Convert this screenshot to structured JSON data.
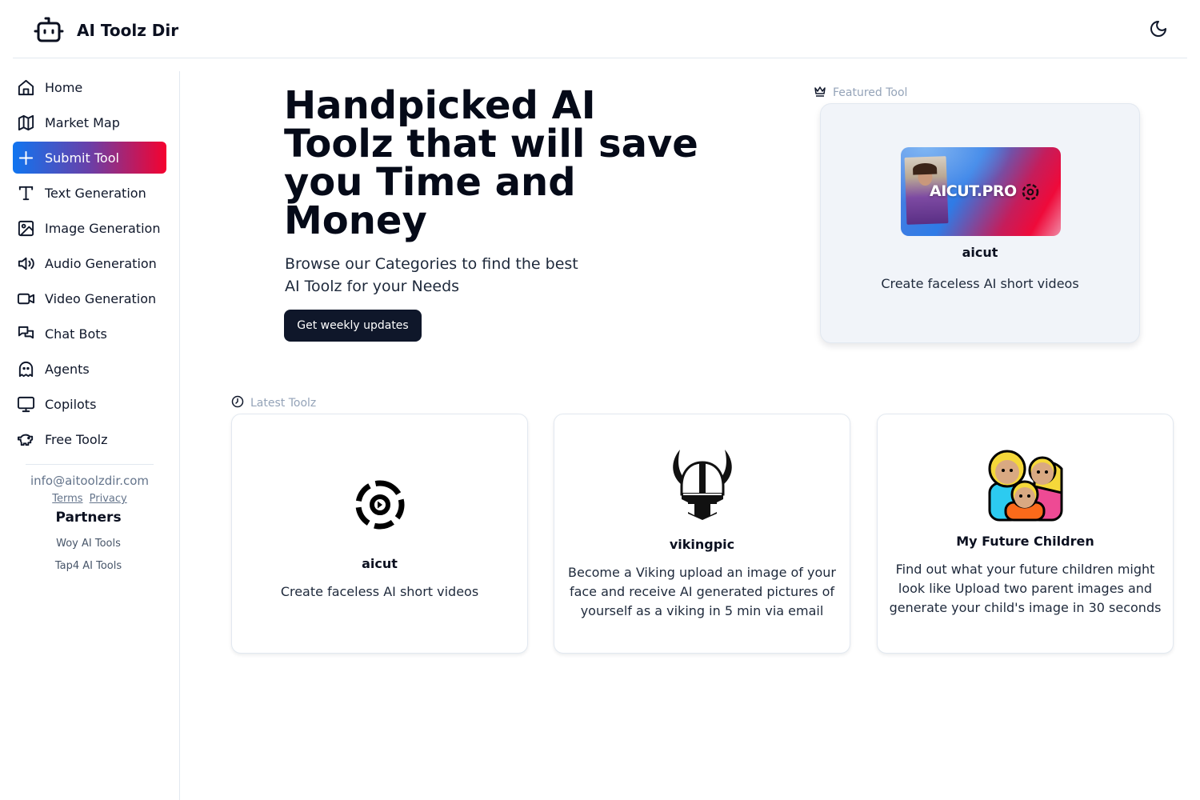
{
  "header": {
    "brand": "AI Toolz Dir",
    "logo_icon": "robot-icon",
    "theme_toggle_icon": "moon-icon"
  },
  "sidebar": {
    "items": [
      {
        "label": "Home",
        "icon": "home-icon",
        "active": false
      },
      {
        "label": "Market Map",
        "icon": "map-icon",
        "active": false
      },
      {
        "label": "Submit Tool",
        "icon": "plus-icon",
        "active": true
      },
      {
        "label": "Text Generation",
        "icon": "text-t-icon",
        "active": false
      },
      {
        "label": "Image Generation",
        "icon": "image-icon",
        "active": false
      },
      {
        "label": "Audio Generation",
        "icon": "speaker-icon",
        "active": false
      },
      {
        "label": "Video Generation",
        "icon": "video-camera-icon",
        "active": false
      },
      {
        "label": "Chat Bots",
        "icon": "chat-bubbles-icon",
        "active": false
      },
      {
        "label": "Agents",
        "icon": "ghost-icon",
        "active": false
      },
      {
        "label": "Copilots",
        "icon": "monitor-icon",
        "active": false
      },
      {
        "label": "Free Toolz",
        "icon": "piggy-bank-icon",
        "active": false
      }
    ],
    "active_gradient": [
      "#1075f0",
      "#f5022f"
    ],
    "contact_email": "info@aitoolzdir.com",
    "terms_label": "Terms",
    "privacy_label": "Privacy",
    "partners_title": "Partners",
    "partners": [
      "Woy AI Tools",
      "Tap4 AI Tools"
    ]
  },
  "hero": {
    "title": "Handpicked AI Toolz that will save you Time and Money",
    "subtitle": "Browse our Categories to find the best AI Toolz for your Needs",
    "cta_label": "Get weekly updates"
  },
  "featured": {
    "section_label": "Featured Tool",
    "section_icon": "crown-icon",
    "tool": {
      "image_text": "AICUT.PRO",
      "name": "aicut",
      "description": "Create faceless AI short videos"
    }
  },
  "latest": {
    "section_label": "Latest Toolz",
    "section_icon": "clock-icon",
    "tools": [
      {
        "name": "aicut",
        "description": "Create faceless AI short videos",
        "logo": "aicut-logo"
      },
      {
        "name": "vikingpic",
        "description": "Become a Viking upload an image of your face and receive AI generated pictures of yourself as a viking in 5 min via email",
        "logo": "viking-helmet-logo"
      },
      {
        "name": "My Future Children",
        "description": "Find out what your future children might look like Upload two parent images and generate your child's image in 30 seconds",
        "logo": "family-emoji-logo"
      }
    ]
  }
}
